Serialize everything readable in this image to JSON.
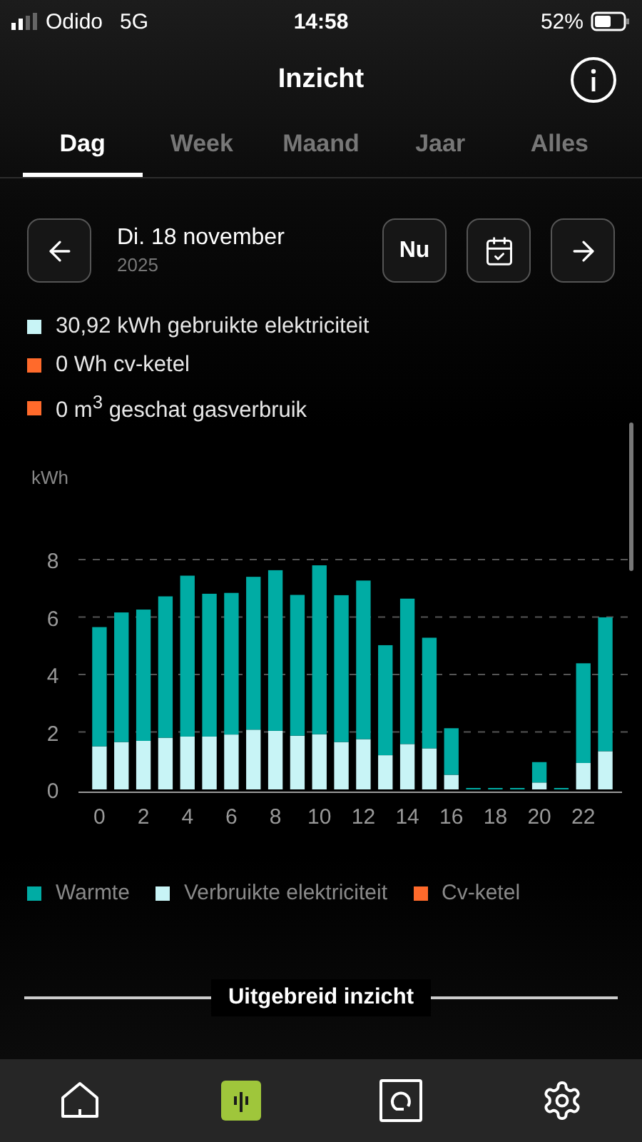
{
  "status_bar": {
    "carrier": "Odido",
    "network": "5G",
    "time": "14:58",
    "battery": "52%"
  },
  "header": {
    "title": "Inzicht"
  },
  "tabs": [
    {
      "label": "Dag",
      "selected": true
    },
    {
      "label": "Week",
      "selected": false
    },
    {
      "label": "Maand",
      "selected": false
    },
    {
      "label": "Jaar",
      "selected": false
    },
    {
      "label": "Alles",
      "selected": false
    }
  ],
  "date_nav": {
    "date": "Di. 18 november",
    "year": "2025",
    "today_button": "Nu"
  },
  "summary": [
    {
      "text": "30,92 kWh gebruikte elektriciteit",
      "color": "#c8f4f6"
    },
    {
      "text": "0 Wh cv-ketel",
      "color": "#ff6a2b"
    },
    {
      "text": "0 m$^{3}$ geschat gasverbruik",
      "color": "#ff6a2b"
    }
  ],
  "chart_data": {
    "type": "bar",
    "stacked": true,
    "ylabel": "kWh",
    "x": [
      0,
      1,
      2,
      3,
      4,
      5,
      6,
      7,
      8,
      9,
      10,
      11,
      12,
      13,
      14,
      15,
      16,
      17,
      18,
      19,
      20,
      21,
      22,
      23
    ],
    "xlim": [
      -0.5,
      23.5
    ],
    "ylim": [
      0,
      8
    ],
    "yticks": [
      0,
      2,
      4,
      6,
      8
    ],
    "xticks": [
      0,
      2,
      4,
      6,
      8,
      10,
      12,
      14,
      16,
      18,
      20,
      22
    ],
    "grid": true,
    "series": [
      {
        "name": "Warmte",
        "color": "#00aca4",
        "values": [
          4.15,
          4.51,
          4.57,
          4.92,
          5.6,
          4.97,
          4.93,
          5.32,
          5.59,
          4.9,
          5.88,
          5.11,
          5.52,
          3.83,
          5.06,
          3.85,
          1.62,
          0.05,
          0.05,
          0.05,
          0.71,
          0.05,
          3.47,
          4.66
        ]
      },
      {
        "name": "Verbruikte elektriciteit",
        "color": "#c8f4f6",
        "values": [
          1.5,
          1.65,
          1.69,
          1.8,
          1.84,
          1.84,
          1.91,
          2.08,
          2.04,
          1.87,
          1.92,
          1.65,
          1.75,
          1.19,
          1.58,
          1.43,
          0.51,
          0,
          0,
          0,
          0.24,
          0,
          0.92,
          1.33
        ]
      },
      {
        "name": "Cv-ketel",
        "color": "#ff6a2b",
        "values": [
          0,
          0,
          0,
          0,
          0,
          0,
          0,
          0,
          0,
          0,
          0,
          0,
          0,
          0,
          0,
          0,
          0,
          0,
          0,
          0,
          0,
          0,
          0,
          0
        ]
      }
    ]
  },
  "section_divider": {
    "label": "Uitgebreid inzicht"
  },
  "bottom_nav": [
    {
      "kind": "home",
      "selected": false
    },
    {
      "kind": "insight",
      "selected": true
    },
    {
      "kind": "device",
      "selected": false
    },
    {
      "kind": "settings",
      "selected": false
    }
  ]
}
